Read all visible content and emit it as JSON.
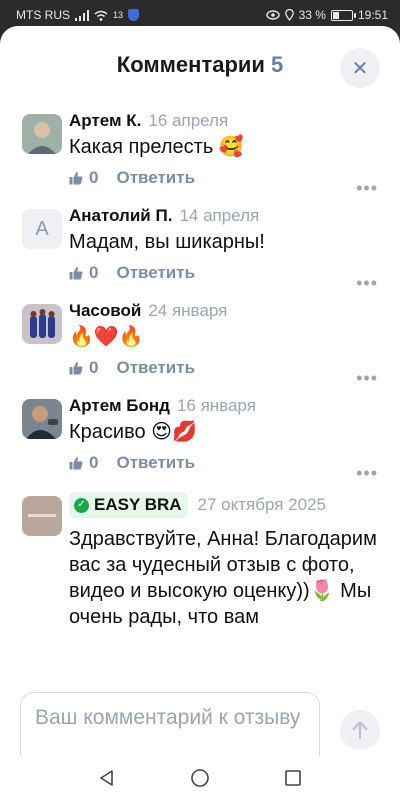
{
  "status_bar": {
    "carrier": "MTS RUS",
    "signal": "13",
    "battery": "33 %",
    "battery_level": 0.33,
    "time": "19:51"
  },
  "header": {
    "title": "Комментарии",
    "count": "5"
  },
  "comments": [
    {
      "author": "Артем К.",
      "date": "16 апреля",
      "text": "Какая прелесть 🥰",
      "likes": "0",
      "reply_label": "Ответить"
    },
    {
      "author": "Анатолий П.",
      "avatar_letter": "А",
      "date": "14 апреля",
      "text": "Мадам, вы шикарны!",
      "likes": "0",
      "reply_label": "Ответить"
    },
    {
      "author": "Часовой",
      "date": "24 января",
      "text": "🔥❤️🔥",
      "likes": "0",
      "reply_label": "Ответить"
    },
    {
      "author": "Артем Бонд",
      "date": "16 января",
      "text": "Красиво 😍💋",
      "likes": "0",
      "reply_label": "Ответить"
    }
  ],
  "shop_reply": {
    "author": "EASY BRA",
    "date": "27 октября 2025",
    "text": "Здравствуйте, Анна! Благодарим вас за чудесный отзыв с фото, видео и высокую оценку))🌷 Мы очень рады, что вам"
  },
  "composer": {
    "placeholder": "Ваш комментарий к отзыву"
  },
  "colors": {
    "accent": "#6b7e99",
    "verified": "#19a84a",
    "badge_bg": "#e7f6ea"
  }
}
